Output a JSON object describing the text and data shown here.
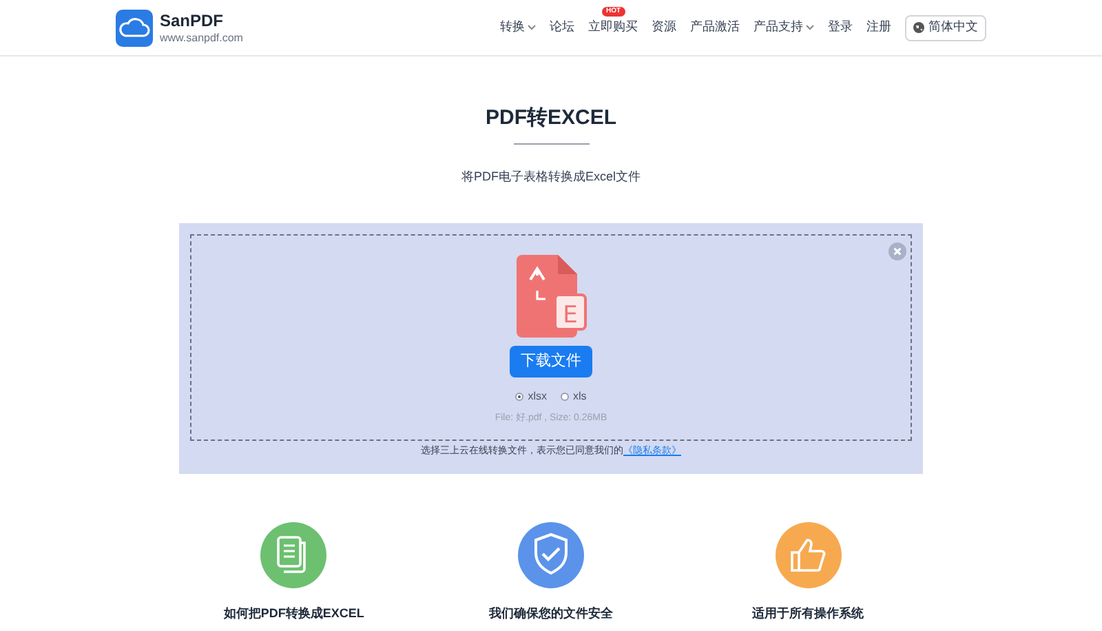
{
  "header": {
    "brand": "SanPDF",
    "url": "www.sanpdf.com",
    "nav": [
      {
        "label": "转换",
        "dropdown": true
      },
      {
        "label": "论坛",
        "dropdown": false
      },
      {
        "label": "立即购买",
        "dropdown": false,
        "badge": "HOT"
      },
      {
        "label": "资源",
        "dropdown": false
      },
      {
        "label": "产品激活",
        "dropdown": false
      },
      {
        "label": "产品支持",
        "dropdown": true
      },
      {
        "label": "登录",
        "dropdown": false
      },
      {
        "label": "注册",
        "dropdown": false
      }
    ],
    "language": "简体中文"
  },
  "title": "PDF转EXCEL",
  "subtitle": "将PDF电子表格转换成Excel文件",
  "converter": {
    "file_icon_letter": "E",
    "download_button": "下载文件",
    "formats": [
      {
        "label": "xlsx",
        "selected": true
      },
      {
        "label": "xls",
        "selected": false
      }
    ],
    "file_info": "File: 好.pdf , Size: 0.26MB",
    "agreement": "选择三上云在线转换文件，表示您已同意我们的",
    "privacy_link": "《隐私条款》"
  },
  "features": [
    {
      "kind": "doc",
      "title": "如何把PDF转换成EXCEL"
    },
    {
      "kind": "shield",
      "title": "我们确保您的文件安全"
    },
    {
      "kind": "thumb",
      "title": "适用于所有操作系统"
    }
  ]
}
